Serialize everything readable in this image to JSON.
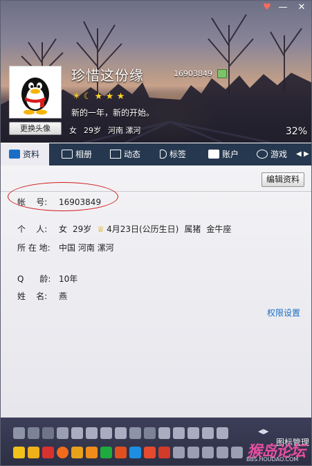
{
  "window": {
    "skin_icon": "shirt-icon",
    "minimize_icon": "minimize-icon",
    "close_icon": "close-icon"
  },
  "profile": {
    "nickname": "珍惜这份缘",
    "qq_number_top": "16903849",
    "mood": "新的一年，新的开始。",
    "gender": "女",
    "age": "29岁",
    "location_short": "河南 漯河",
    "change_avatar_label": "更换头像",
    "completion_percent": "32%"
  },
  "tabs": [
    {
      "label": "资料",
      "icon": "profile-card-icon",
      "active": true
    },
    {
      "label": "相册",
      "icon": "photo-album-icon",
      "active": false
    },
    {
      "label": "动态",
      "icon": "feed-icon",
      "active": false
    },
    {
      "label": "标签",
      "icon": "tag-icon",
      "active": false
    },
    {
      "label": "账户",
      "icon": "wallet-icon",
      "active": false
    },
    {
      "label": "游戏",
      "icon": "game-icon",
      "active": false
    }
  ],
  "details": {
    "edit_button": "编辑资料",
    "account_label": "帐    号:",
    "account_value": "16903849",
    "person_label": "个    人:",
    "person_gender": "女",
    "person_age": "29岁",
    "birthday": "4月23日(公历生日)",
    "zodiac": "属猪",
    "constellation": "金牛座",
    "location_label": "所 在 地:",
    "location_value": "中国 河南 漯河",
    "qage_label": "Q      龄:",
    "qage_value": "10年",
    "name_label": "姓    名:",
    "name_value": "燕",
    "permission_link": "权限设置"
  },
  "bottom": {
    "icon_manager": "图标管理",
    "watermark": "猴岛论坛",
    "watermark_sub": "BBS.HOUDAO.COM"
  },
  "colors": {
    "accent": "#1a6ec6",
    "tabbar": "#26384f",
    "oval": "#d11818"
  }
}
